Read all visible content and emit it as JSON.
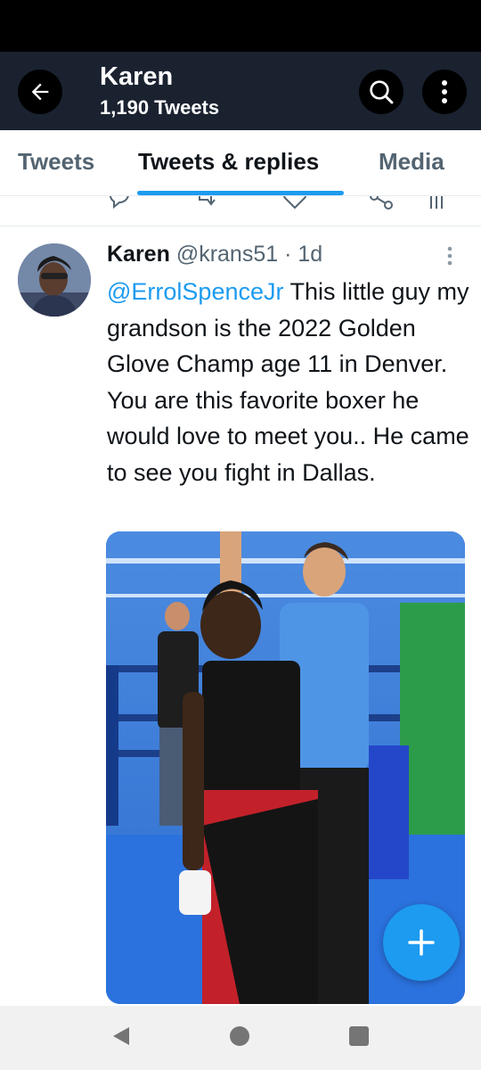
{
  "header": {
    "title": "Karen",
    "subtitle": "1,190 Tweets",
    "back_icon": "arrow-left-icon",
    "search_icon": "search-icon",
    "more_icon": "more-vertical-icon"
  },
  "tabs": [
    {
      "label": "Tweets",
      "active": false
    },
    {
      "label": "Tweets & replies",
      "active": true
    },
    {
      "label": "Media",
      "active": false
    }
  ],
  "tweet": {
    "author_name": "Karen",
    "handle": "@krans51",
    "separator": "·",
    "time": "1d",
    "mention": "@ErrolSpenceJr",
    "text": " This little guy my grandson is the 2022 Golden Glove Champ age 11 in Denver. You are this favorite boxer he would love to meet you.. He came to see you fight in Dallas."
  },
  "fab": {
    "icon": "plus-icon"
  },
  "colors": {
    "accent": "#1d9bf0",
    "header_bg": "#1a2230",
    "muted_text": "#536471"
  }
}
